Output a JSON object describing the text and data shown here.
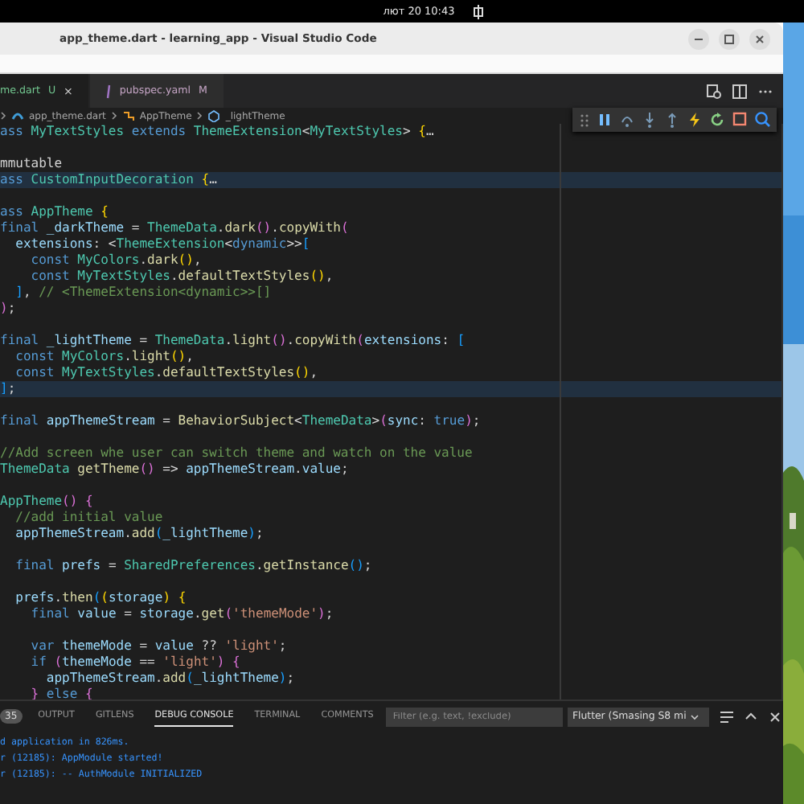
{
  "top_bar": {
    "clock": "лют 20  10:43"
  },
  "window": {
    "title": "app_theme.dart - learning_app - Visual Studio Code"
  },
  "tabs": [
    {
      "label": "me.dart",
      "badge": "U",
      "selected": true,
      "close": "×"
    },
    {
      "label": "pubspec.yaml",
      "badge": "M",
      "selected": false
    }
  ],
  "breadcrumbs": [
    "app_theme.dart",
    "AppTheme",
    "_lightTheme"
  ],
  "code": [
    {
      "highlighted": false,
      "tokens": [
        {
          "kind": "k",
          "text": "ass "
        },
        {
          "kind": "t",
          "text": "MyTextStyles "
        },
        {
          "kind": "k",
          "text": "extends "
        },
        {
          "kind": "t",
          "text": "ThemeExtension"
        },
        {
          "kind": "p",
          "text": "<"
        },
        {
          "kind": "t",
          "text": "MyTextStyles"
        },
        {
          "kind": "p",
          "text": "> "
        },
        {
          "kind": "b1",
          "text": "{"
        },
        {
          "kind": "p",
          "text": "…"
        }
      ]
    },
    {
      "highlighted": false
    },
    {
      "highlighted": false,
      "tokens": [
        {
          "kind": "p",
          "text": "mmutable"
        }
      ]
    },
    {
      "highlighted": true,
      "tokens": [
        {
          "kind": "k",
          "text": "ass "
        },
        {
          "kind": "t",
          "text": "CustomInputDecoration "
        },
        {
          "kind": "b1",
          "text": "{"
        },
        {
          "kind": "p",
          "text": "…"
        }
      ]
    },
    {
      "highlighted": false
    },
    {
      "highlighted": false,
      "tokens": [
        {
          "kind": "k",
          "text": "ass "
        },
        {
          "kind": "t",
          "text": "AppTheme "
        },
        {
          "kind": "b1",
          "text": "{"
        }
      ]
    },
    {
      "highlighted": false,
      "tokens": [
        {
          "kind": "k",
          "text": "final "
        },
        {
          "kind": "v",
          "text": "_darkTheme "
        },
        {
          "kind": "p",
          "text": "= "
        },
        {
          "kind": "t",
          "text": "ThemeData"
        },
        {
          "kind": "p",
          "text": "."
        },
        {
          "kind": "f",
          "text": "dark"
        },
        {
          "kind": "b2",
          "text": "()"
        },
        {
          "kind": "p",
          "text": "."
        },
        {
          "kind": "f",
          "text": "copyWith"
        },
        {
          "kind": "b2",
          "text": "("
        }
      ]
    },
    {
      "highlighted": false,
      "tokens": [
        {
          "kind": "v",
          "text": "  extensions"
        },
        {
          "kind": "p",
          "text": ": <"
        },
        {
          "kind": "t",
          "text": "ThemeExtension"
        },
        {
          "kind": "p",
          "text": "<"
        },
        {
          "kind": "k",
          "text": "dynamic"
        },
        {
          "kind": "p",
          "text": ">>"
        },
        {
          "kind": "b3",
          "text": "["
        }
      ]
    },
    {
      "highlighted": false,
      "tokens": [
        {
          "kind": "k",
          "text": "    const "
        },
        {
          "kind": "t",
          "text": "MyColors"
        },
        {
          "kind": "p",
          "text": "."
        },
        {
          "kind": "f",
          "text": "dark"
        },
        {
          "kind": "b1",
          "text": "()"
        },
        {
          "kind": "p",
          "text": ","
        }
      ]
    },
    {
      "highlighted": false,
      "tokens": [
        {
          "kind": "k",
          "text": "    const "
        },
        {
          "kind": "t",
          "text": "MyTextStyles"
        },
        {
          "kind": "p",
          "text": "."
        },
        {
          "kind": "f",
          "text": "defaultTextStyles"
        },
        {
          "kind": "b1",
          "text": "()"
        },
        {
          "kind": "p",
          "text": ","
        }
      ]
    },
    {
      "highlighted": false,
      "tokens": [
        {
          "kind": "b3",
          "text": "  ]"
        },
        {
          "kind": "p",
          "text": ", "
        },
        {
          "kind": "c",
          "text": "// <ThemeExtension<dynamic>>[]"
        }
      ]
    },
    {
      "highlighted": false,
      "tokens": [
        {
          "kind": "b2",
          "text": ")"
        },
        {
          "kind": "p",
          "text": ";"
        }
      ]
    },
    {
      "highlighted": false
    },
    {
      "highlighted": false,
      "tokens": [
        {
          "kind": "k",
          "text": "final "
        },
        {
          "kind": "v",
          "text": "_lightTheme "
        },
        {
          "kind": "p",
          "text": "= "
        },
        {
          "kind": "t",
          "text": "ThemeData"
        },
        {
          "kind": "p",
          "text": "."
        },
        {
          "kind": "f",
          "text": "light"
        },
        {
          "kind": "b2",
          "text": "()"
        },
        {
          "kind": "p",
          "text": "."
        },
        {
          "kind": "f",
          "text": "copyWith"
        },
        {
          "kind": "b2",
          "text": "("
        },
        {
          "kind": "v",
          "text": "extensions"
        },
        {
          "kind": "p",
          "text": ": "
        },
        {
          "kind": "b3",
          "text": "["
        }
      ]
    },
    {
      "highlighted": false,
      "tokens": [
        {
          "kind": "k",
          "text": "  const "
        },
        {
          "kind": "t",
          "text": "MyColors"
        },
        {
          "kind": "p",
          "text": "."
        },
        {
          "kind": "f",
          "text": "light"
        },
        {
          "kind": "b1",
          "text": "()"
        },
        {
          "kind": "p",
          "text": ","
        }
      ]
    },
    {
      "highlighted": false,
      "tokens": [
        {
          "kind": "k",
          "text": "  const "
        },
        {
          "kind": "t",
          "text": "MyTextStyles"
        },
        {
          "kind": "p",
          "text": "."
        },
        {
          "kind": "f",
          "text": "defaultTextStyles"
        },
        {
          "kind": "b1",
          "text": "()"
        },
        {
          "kind": "p",
          "text": ","
        }
      ]
    },
    {
      "highlighted": true,
      "tokens": [
        {
          "kind": "b3",
          "text": "]"
        },
        {
          "kind": "p",
          "text": ";"
        }
      ]
    },
    {
      "highlighted": false
    },
    {
      "highlighted": false,
      "tokens": [
        {
          "kind": "k",
          "text": "final "
        },
        {
          "kind": "v",
          "text": "appThemeStream "
        },
        {
          "kind": "p",
          "text": "= "
        },
        {
          "kind": "f",
          "text": "BehaviorSubject"
        },
        {
          "kind": "p",
          "text": "<"
        },
        {
          "kind": "t",
          "text": "ThemeData"
        },
        {
          "kind": "p",
          "text": ">"
        },
        {
          "kind": "b2",
          "text": "("
        },
        {
          "kind": "v",
          "text": "sync"
        },
        {
          "kind": "p",
          "text": ": "
        },
        {
          "kind": "k",
          "text": "true"
        },
        {
          "kind": "b2",
          "text": ")"
        },
        {
          "kind": "p",
          "text": ";"
        }
      ]
    },
    {
      "highlighted": false
    },
    {
      "highlighted": false,
      "tokens": [
        {
          "kind": "c",
          "text": "//Add screen whe user can switch theme and watch on the value"
        }
      ]
    },
    {
      "highlighted": false,
      "tokens": [
        {
          "kind": "t",
          "text": "ThemeData "
        },
        {
          "kind": "f",
          "text": "getTheme"
        },
        {
          "kind": "b2",
          "text": "()"
        },
        {
          "kind": "p",
          "text": " => "
        },
        {
          "kind": "v",
          "text": "appThemeStream"
        },
        {
          "kind": "p",
          "text": "."
        },
        {
          "kind": "v",
          "text": "value"
        },
        {
          "kind": "p",
          "text": ";"
        }
      ]
    },
    {
      "highlighted": false
    },
    {
      "highlighted": false,
      "tokens": [
        {
          "kind": "t",
          "text": "AppTheme"
        },
        {
          "kind": "b2",
          "text": "() {"
        }
      ]
    },
    {
      "highlighted": false,
      "tokens": [
        {
          "kind": "c",
          "text": "  //add initial value"
        }
      ]
    },
    {
      "highlighted": false,
      "tokens": [
        {
          "kind": "v",
          "text": "  appThemeStream"
        },
        {
          "kind": "p",
          "text": "."
        },
        {
          "kind": "f",
          "text": "add"
        },
        {
          "kind": "b3",
          "text": "("
        },
        {
          "kind": "v",
          "text": "_lightTheme"
        },
        {
          "kind": "b3",
          "text": ")"
        },
        {
          "kind": "p",
          "text": ";"
        }
      ]
    },
    {
      "highlighted": false
    },
    {
      "highlighted": false,
      "tokens": [
        {
          "kind": "k",
          "text": "  final "
        },
        {
          "kind": "v",
          "text": "prefs "
        },
        {
          "kind": "p",
          "text": "= "
        },
        {
          "kind": "t",
          "text": "SharedPreferences"
        },
        {
          "kind": "p",
          "text": "."
        },
        {
          "kind": "f",
          "text": "getInstance"
        },
        {
          "kind": "b3",
          "text": "()"
        },
        {
          "kind": "p",
          "text": ";"
        }
      ]
    },
    {
      "highlighted": false
    },
    {
      "highlighted": false,
      "tokens": [
        {
          "kind": "v",
          "text": "  prefs"
        },
        {
          "kind": "p",
          "text": "."
        },
        {
          "kind": "f",
          "text": "then"
        },
        {
          "kind": "b3",
          "text": "("
        },
        {
          "kind": "b1",
          "text": "("
        },
        {
          "kind": "v",
          "text": "storage"
        },
        {
          "kind": "b1",
          "text": ") {"
        }
      ]
    },
    {
      "highlighted": false,
      "tokens": [
        {
          "kind": "k",
          "text": "    final "
        },
        {
          "kind": "v",
          "text": "value "
        },
        {
          "kind": "p",
          "text": "= "
        },
        {
          "kind": "v",
          "text": "storage"
        },
        {
          "kind": "p",
          "text": "."
        },
        {
          "kind": "f",
          "text": "get"
        },
        {
          "kind": "b2",
          "text": "("
        },
        {
          "kind": "s",
          "text": "'themeMode'"
        },
        {
          "kind": "b2",
          "text": ")"
        },
        {
          "kind": "p",
          "text": ";"
        }
      ]
    },
    {
      "highlighted": false
    },
    {
      "highlighted": false,
      "tokens": [
        {
          "kind": "k",
          "text": "    var "
        },
        {
          "kind": "v",
          "text": "themeMode "
        },
        {
          "kind": "p",
          "text": "= "
        },
        {
          "kind": "v",
          "text": "value "
        },
        {
          "kind": "p",
          "text": "?? "
        },
        {
          "kind": "s",
          "text": "'light'"
        },
        {
          "kind": "p",
          "text": ";"
        }
      ]
    },
    {
      "highlighted": false,
      "tokens": [
        {
          "kind": "k",
          "text": "    if "
        },
        {
          "kind": "b2",
          "text": "("
        },
        {
          "kind": "v",
          "text": "themeMode "
        },
        {
          "kind": "p",
          "text": "== "
        },
        {
          "kind": "s",
          "text": "'light'"
        },
        {
          "kind": "b2",
          "text": ") {"
        }
      ]
    },
    {
      "highlighted": false,
      "tokens": [
        {
          "kind": "v",
          "text": "      appThemeStream"
        },
        {
          "kind": "p",
          "text": "."
        },
        {
          "kind": "f",
          "text": "add"
        },
        {
          "kind": "b3",
          "text": "("
        },
        {
          "kind": "v",
          "text": "_lightTheme"
        },
        {
          "kind": "b3",
          "text": ")"
        },
        {
          "kind": "p",
          "text": ";"
        }
      ]
    },
    {
      "highlighted": false,
      "tokens": [
        {
          "kind": "b2",
          "text": "    } "
        },
        {
          "kind": "k",
          "text": "else "
        },
        {
          "kind": "b2",
          "text": "{"
        }
      ]
    }
  ],
  "panel": {
    "problems_count": "35",
    "tabs": [
      {
        "label": "OUTPUT",
        "selected": false
      },
      {
        "label": "GITLENS",
        "selected": false
      },
      {
        "label": "DEBUG CONSOLE",
        "selected": true
      },
      {
        "label": "TERMINAL",
        "selected": false
      },
      {
        "label": "COMMENTS",
        "selected": false
      }
    ],
    "filter": {
      "placeholder": "Filter (e.g. text, !exclude)"
    },
    "session": "Flutter (Smasing S8 mi",
    "console": [
      "d application in 826ms.",
      "r (12185): AppModule started!",
      "r (12185): -- AuthModule INITIALIZED"
    ]
  }
}
